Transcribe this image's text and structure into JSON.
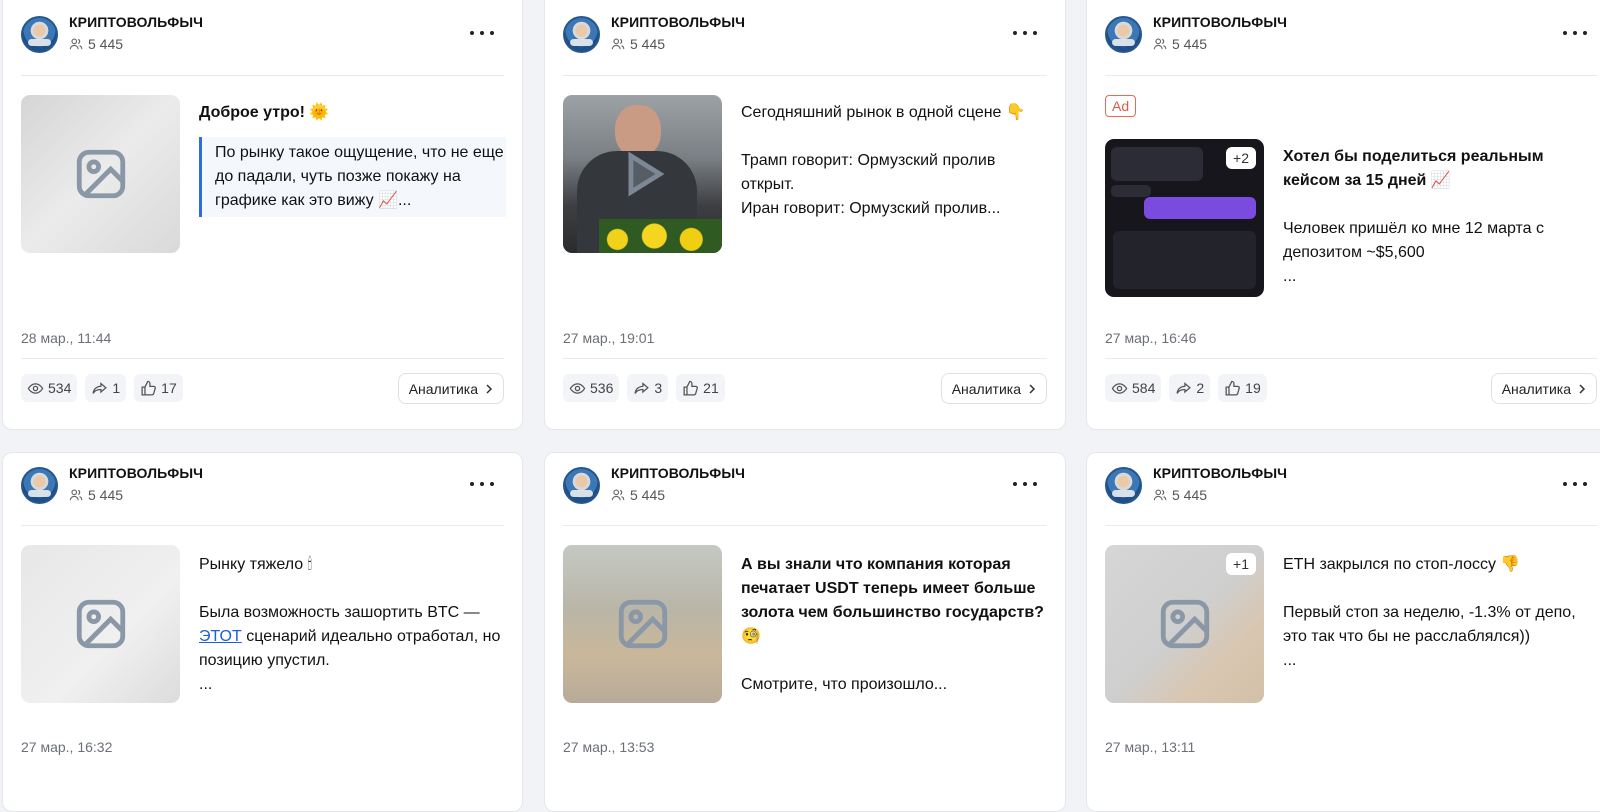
{
  "channel": {
    "name": "КРИПТОВОЛЬФЫЧ",
    "subscribers": "5 445"
  },
  "posts": [
    {
      "title": "Доброе утро! 🌞",
      "text": "По рынку такое ощущение, что не еще до падали, чуть позже покажу на графике как это вижу 📈...",
      "date": "28 мар., 11:44",
      "views": "534",
      "shares": "1",
      "likes": "17",
      "thumb_icon": "image-placeholder-icon"
    },
    {
      "title": "Сегодняшний рынок в одной сцене 👇",
      "text_line1": "Трамп говорит: Ормузский пролив открыт.",
      "text_line2": "Иран говорит: Ормузский пролив...",
      "date": "27 мар., 19:01",
      "views": "536",
      "shares": "3",
      "likes": "21",
      "thumb_icon": "play-icon"
    },
    {
      "ad_label": "Ad",
      "badge": "+2",
      "title": "Хотел бы поделиться реальным кейсом за 15 дней 📈",
      "text": "Человек пришёл ко мне 12 марта с депозитом ~$5,600",
      "ellipsis": "...",
      "date": "27 мар., 16:46",
      "views": "584",
      "shares": "2",
      "likes": "19"
    },
    {
      "title": "Рынку тяжело 🕯",
      "text_before": "Была возможность зашортить BTC — ",
      "link": "ЭТОТ",
      "text_after": " сценарий идеально отработал, но позицию упустил.",
      "ellipsis": "...",
      "date": "27 мар., 16:32"
    },
    {
      "title": "А вы знали что компания которая печатает USDT теперь имеет больше золота чем большинство государств? 🧐",
      "text": "Смотрите, что произошло...",
      "date": "27 мар., 13:53"
    },
    {
      "badge": "+1",
      "title": "ETH закрылся по стоп-лоссу 👎",
      "text": "Первый стоп за неделю, -1.3% от депо, это так что бы не расслаблялся))",
      "ellipsis": "...",
      "date": "27 мар., 13:11"
    }
  ],
  "analytics_label": "Аналитика"
}
